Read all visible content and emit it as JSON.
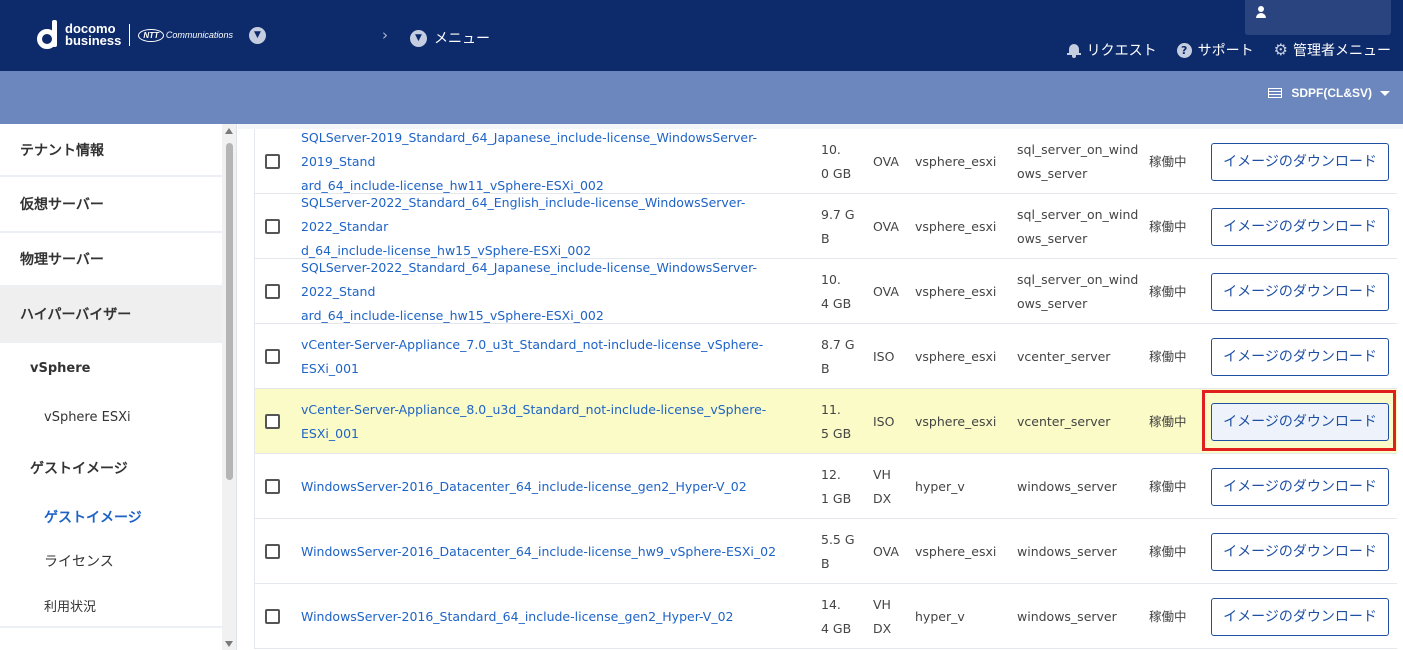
{
  "header": {
    "logo": {
      "line1": "docomo",
      "line2": "business",
      "partner_oval": "NTT",
      "partner_text": "Communications"
    },
    "breadcrumb_menu": "メニュー",
    "links": {
      "request": "リクエスト",
      "support": "サポート",
      "admin_menu": "管理者メニュー"
    }
  },
  "subheader": {
    "tenant": "SDPF(CL&SV)"
  },
  "sidebar": {
    "items": [
      "テナント情報",
      "仮想サーバー",
      "物理サーバー",
      "ハイパーバイザー"
    ],
    "sub_vsphere": "vSphere",
    "sub_vsphere_esxi": "vSphere ESXi",
    "sub_guest_image_group": "ゲストイメージ",
    "sub_guest_image_active": "ゲストイメージ",
    "sub_license": "ライセンス",
    "sub_usage": "利用状況"
  },
  "table": {
    "button_label": "イメージのダウンロード",
    "rows": [
      {
        "name_l1": "SQLServer-2019_Standard_64_Japanese_include-license_WindowsServer-2019_Stand",
        "name_l2": "ard_64_include-license_hw11_vSphere-ESXi_002",
        "size_l1": "10.",
        "size_l2": "0 GB",
        "fmt_l1": "OVA",
        "fmt_l2": "",
        "hyp": "vsphere_esxi",
        "os_l1": "sql_server_on_wind",
        "os_l2": "ows_server",
        "status": "稼働中"
      },
      {
        "name_l1": "SQLServer-2022_Standard_64_English_include-license_WindowsServer-2022_Standar",
        "name_l2": "d_64_include-license_hw15_vSphere-ESXi_002",
        "size_l1": "9.7 G",
        "size_l2": "B",
        "fmt_l1": "OVA",
        "fmt_l2": "",
        "hyp": "vsphere_esxi",
        "os_l1": "sql_server_on_wind",
        "os_l2": "ows_server",
        "status": "稼働中"
      },
      {
        "name_l1": "SQLServer-2022_Standard_64_Japanese_include-license_WindowsServer-2022_Stand",
        "name_l2": "ard_64_include-license_hw15_vSphere-ESXi_002",
        "size_l1": "10.",
        "size_l2": "4 GB",
        "fmt_l1": "OVA",
        "fmt_l2": "",
        "hyp": "vsphere_esxi",
        "os_l1": "sql_server_on_wind",
        "os_l2": "ows_server",
        "status": "稼働中"
      },
      {
        "name_l1": "vCenter-Server-Appliance_7.0_u3t_Standard_not-include-license_vSphere-ESXi_001",
        "name_l2": "",
        "size_l1": "8.7 G",
        "size_l2": "B",
        "fmt_l1": "ISO",
        "fmt_l2": "",
        "hyp": "vsphere_esxi",
        "os_l1": "vcenter_server",
        "os_l2": "",
        "status": "稼働中"
      },
      {
        "name_l1": "vCenter-Server-Appliance_8.0_u3d_Standard_not-include-license_vSphere-ESXi_001",
        "name_l2": "",
        "size_l1": "11.",
        "size_l2": "5 GB",
        "fmt_l1": "ISO",
        "fmt_l2": "",
        "hyp": "vsphere_esxi",
        "os_l1": "vcenter_server",
        "os_l2": "",
        "status": "稼働中"
      },
      {
        "name_l1": "WindowsServer-2016_Datacenter_64_include-license_gen2_Hyper-V_02",
        "name_l2": "",
        "size_l1": "12.",
        "size_l2": "1 GB",
        "fmt_l1": "VH",
        "fmt_l2": "DX",
        "hyp": "hyper_v",
        "os_l1": "windows_server",
        "os_l2": "",
        "status": "稼働中"
      },
      {
        "name_l1": "WindowsServer-2016_Datacenter_64_include-license_hw9_vSphere-ESXi_02",
        "name_l2": "",
        "size_l1": "5.5 G",
        "size_l2": "B",
        "fmt_l1": "OVA",
        "fmt_l2": "",
        "hyp": "vsphere_esxi",
        "os_l1": "windows_server",
        "os_l2": "",
        "status": "稼働中"
      },
      {
        "name_l1": "WindowsServer-2016_Standard_64_include-license_gen2_Hyper-V_02",
        "name_l2": "",
        "size_l1": "14.",
        "size_l2": "4 GB",
        "fmt_l1": "VH",
        "fmt_l2": "DX",
        "hyp": "hyper_v",
        "os_l1": "windows_server",
        "os_l2": "",
        "status": "稼働中"
      }
    ]
  },
  "colors": {
    "header_bg": "#0d2a6b",
    "subheader_bg": "#6b87bd",
    "link": "#1e63c6",
    "highlight_row": "#fafbc6",
    "annotation_frame": "#e0201e"
  }
}
